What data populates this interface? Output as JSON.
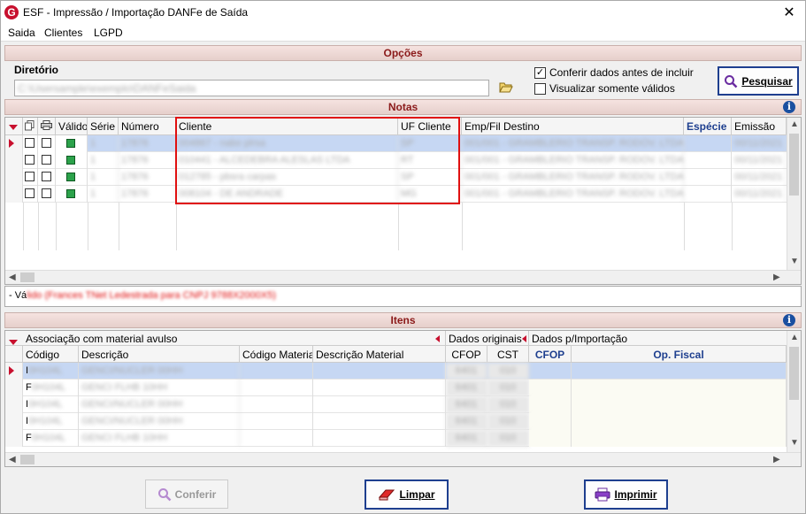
{
  "window": {
    "title": "ESF - Impressão / Importação DANFe de Saída",
    "logo": "G",
    "close": "✕"
  },
  "menu": [
    "Saida",
    "Clientes",
    "LGPD"
  ],
  "opcoes": {
    "header": "Opções",
    "dir_label": "Diretório",
    "dir_value": "C:\\Usersample\\exemplo\\DANFeSaida",
    "check1": {
      "label": "Conferir dados antes de incluir",
      "checked": true
    },
    "check2": {
      "label": "Visualizar somente válidos",
      "checked": false
    },
    "search_button": "Pesquisar"
  },
  "notas": {
    "header": "Notas",
    "columns": [
      "",
      "",
      "",
      "Válido",
      "Série",
      "Número",
      "Cliente",
      "UF Cliente",
      "Emp/Fil Destino",
      "Espécie",
      "Emissão"
    ],
    "rows": [
      {
        "serie": "1",
        "numero": "17876",
        "cliente": "004867 - nabo plrsa",
        "uf": "SP",
        "emp": "001/001 - GRAMBLERIO TRANSP. RODOV. LTDA",
        "emissao": "00/11/2021"
      },
      {
        "serie": "1",
        "numero": "17876",
        "cliente": "010441 - ALCEDEBRA ALESLAS LTDA",
        "uf": "RT",
        "emp": "001/001 - GRAMBLERIO TRANSP. RODOV. LTDA",
        "emissao": "00/11/2021"
      },
      {
        "serie": "1",
        "numero": "17876",
        "cliente": "012785 - pbsra carpas",
        "uf": "SP",
        "emp": "001/001 - GRAMBLERIO TRANSP. RODOV. LTDA",
        "emissao": "00/11/2021"
      },
      {
        "serie": "1",
        "numero": "17876",
        "cliente": "008104 - DE ANDRADE",
        "uf": "MG",
        "emp": "001/001 - GRAMBLERIO TRANSP. RODOV. LTDA",
        "emissao": "00/11/2021"
      }
    ],
    "message_prefix": "- Vá",
    "message_rest": "lido (Frances TNet Ledestrada para CNPJ 9788X2000X5)"
  },
  "itens": {
    "header": "Itens",
    "group1": "Associação com material avulso",
    "group2": "Dados originais",
    "group3": "Dados p/Importação",
    "columns": [
      "Código",
      "Descrição",
      "Código Material",
      "Descrição Material",
      "CFOP",
      "CST",
      "CFOP",
      "Op. Fiscal"
    ],
    "rows": [
      {
        "codigo": "I",
        "codigo_rest": "0H104L",
        "descricao": "GENCI/NUCLER 00HH",
        "cfop": "6401",
        "cst": "010"
      },
      {
        "codigo": "F",
        "codigo_rest": "0H104L",
        "descricao": "GENCI FLHB 10HH",
        "cfop": "6401",
        "cst": "010"
      },
      {
        "codigo": "I",
        "codigo_rest": "0H104L",
        "descricao": "GENCI/NUCLER 00HH",
        "cfop": "6401",
        "cst": "010"
      },
      {
        "codigo": "I",
        "codigo_rest": "0H104L",
        "descricao": "GENCI/NUCLER 00HH",
        "cfop": "6401",
        "cst": "010"
      },
      {
        "codigo": "F",
        "codigo_rest": "0H104L",
        "descricao": "GENCI FLHB 10HH",
        "cfop": "6401",
        "cst": "010"
      }
    ]
  },
  "footer": {
    "conferir": "Conferir",
    "limpar": "Limpar",
    "imprimir": "Imprimir"
  }
}
